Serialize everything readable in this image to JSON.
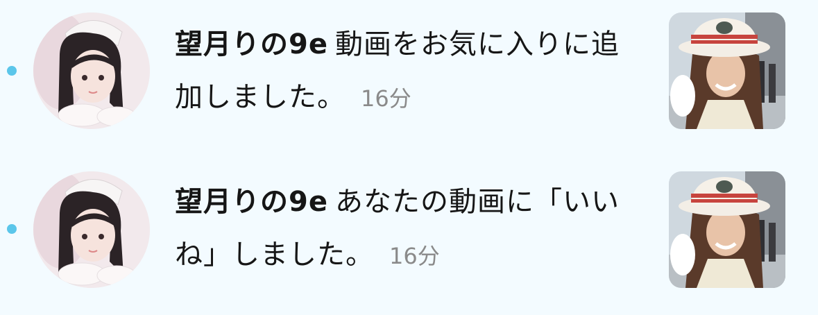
{
  "colors": {
    "background": "#f3fbff",
    "unread_dot": "#5bc6ea",
    "time_text": "#8a8a8a"
  },
  "notifications": [
    {
      "username": "望月りの9e",
      "message": "動画をお気に入りに追加しました。",
      "time": "16分",
      "avatar_icon": "user-avatar-photo",
      "thumbnail_icon": "video-thumbnail-photo",
      "unread": true
    },
    {
      "username": "望月りの9e",
      "message": "あなたの動画に「いいね」しました。",
      "time": "16分",
      "avatar_icon": "user-avatar-photo",
      "thumbnail_icon": "video-thumbnail-photo",
      "unread": true
    }
  ]
}
